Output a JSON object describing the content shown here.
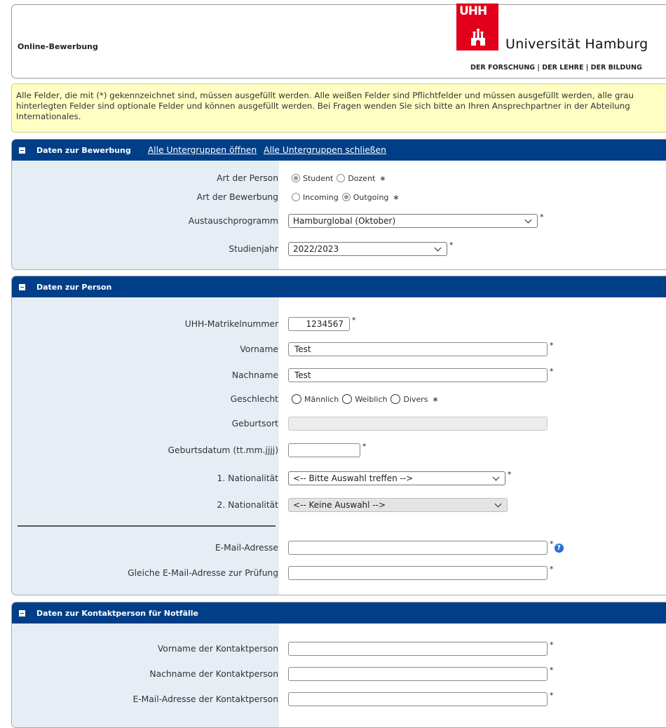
{
  "header": {
    "title": "Online-Bewerbung",
    "logo_abbrev": "UHH",
    "logo_name": "Universität Hamburg",
    "logo_motto": "DER FORSCHUNG | DER LEHRE | DER BILDUNG"
  },
  "notice": "Alle Felder, die mit (*) gekennzeichnet sind, müssen ausgefüllt werden. Alle weißen Felder sind Pflichtfelder und müssen ausgefüllt werden, alle grau hinterlegten Felder sind optionale Felder und können ausgefüllt werden. Bei Fragen wenden Sie sich bitte an Ihren Ansprechpartner in der Abteilung Internationales.",
  "required_mark": "*",
  "radio_required_mark": "∗",
  "help_glyph": "?",
  "sections": {
    "bewerbung": {
      "title": "Daten zur Bewerbung",
      "open_all": "Alle Untergruppen öffnen",
      "close_all": "Alle Untergruppen schließen",
      "art_person_label": "Art der Person",
      "art_person_options": [
        "Student",
        "Dozent"
      ],
      "art_person_selected": "Student",
      "art_bewerbung_label": "Art der Bewerbung",
      "art_bewerbung_options": [
        "Incoming",
        "Outgoing"
      ],
      "art_bewerbung_selected": "Outgoing",
      "austausch_label": "Austauschprogramm",
      "austausch_value": "Hamburglobal (Oktober)",
      "studienjahr_label": "Studienjahr",
      "studienjahr_value": "2022/2023"
    },
    "person": {
      "title": "Daten zur Person",
      "matrikel_label": "UHH-Matrikelnummer",
      "matrikel_value": "1234567",
      "vorname_label": "Vorname",
      "vorname_value": "Test",
      "nachname_label": "Nachname",
      "nachname_value": "Test",
      "geschlecht_label": "Geschlecht",
      "geschlecht_options": [
        "Männlich",
        "Weiblich",
        "Divers"
      ],
      "geburtsort_label": "Geburtsort",
      "geburtsort_value": "",
      "geburtsdatum_label": "Geburtsdatum (tt.mm.jjjj)",
      "geburtsdatum_value": "",
      "nat1_label": "1. Nationalität",
      "nat1_value": "<-- Bitte Auswahl treffen -->",
      "nat2_label": "2. Nationalität",
      "nat2_value": "<-- Keine Auswahl -->",
      "email_label": "E-Mail-Adresse",
      "email_value": "",
      "email_confirm_label": "Gleiche E-Mail-Adresse zur Prüfung",
      "email_confirm_value": ""
    },
    "kontakt": {
      "title": "Daten zur Kontaktperson für Notfälle",
      "vorname_label": "Vorname der Kontaktperson",
      "vorname_value": "",
      "nachname_label": "Nachname der Kontaktperson",
      "nachname_value": "",
      "email_label": "E-Mail-Adresse der Kontaktperson",
      "email_value": ""
    }
  }
}
